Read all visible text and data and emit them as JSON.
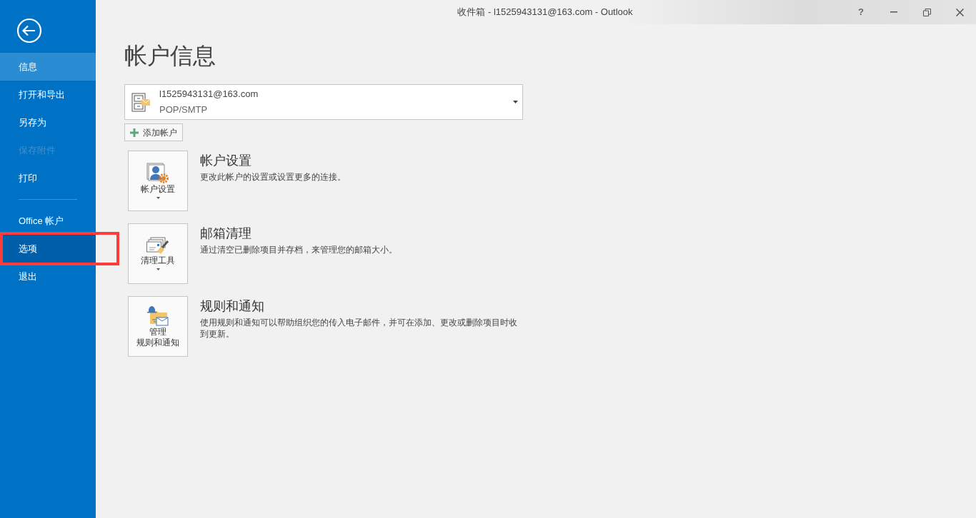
{
  "window": {
    "title": "收件箱 - l1525943131@163.com - Outlook",
    "help": "?"
  },
  "sidebar": {
    "items": [
      {
        "kind": "item",
        "label": "信息",
        "selected": true,
        "disabled": false,
        "hovered": false,
        "marked": false
      },
      {
        "kind": "item",
        "label": "打开和导出",
        "selected": false,
        "disabled": false,
        "hovered": false,
        "marked": false
      },
      {
        "kind": "item",
        "label": "另存为",
        "selected": false,
        "disabled": false,
        "hovered": false,
        "marked": false
      },
      {
        "kind": "item",
        "label": "保存附件",
        "selected": false,
        "disabled": true,
        "hovered": false,
        "marked": false
      },
      {
        "kind": "item",
        "label": "打印",
        "selected": false,
        "disabled": false,
        "hovered": false,
        "marked": false
      },
      {
        "kind": "separator"
      },
      {
        "kind": "item",
        "label": "Office 帐户",
        "selected": false,
        "disabled": false,
        "hovered": false,
        "marked": false
      },
      {
        "kind": "item",
        "label": "选项",
        "selected": false,
        "disabled": false,
        "hovered": true,
        "marked": true
      },
      {
        "kind": "item",
        "label": "退出",
        "selected": false,
        "disabled": false,
        "hovered": false,
        "marked": false
      }
    ]
  },
  "page": {
    "title": "帐户信息",
    "account": {
      "email": "l1525943131@163.com",
      "type": "POP/SMTP"
    },
    "add_account": "添加帐户",
    "sections": [
      {
        "kind": "settings",
        "button": [
          "帐户设置"
        ],
        "dropdown": true,
        "title": "帐户设置",
        "description": "更改此帐户的设置或设置更多的连接。"
      },
      {
        "kind": "cleanup",
        "button": [
          "清理工具"
        ],
        "dropdown": true,
        "title": "邮箱清理",
        "description": "通过清空已删除项目并存档，来管理您的邮箱大小。"
      },
      {
        "kind": "rules",
        "button": [
          "管理",
          "规则和通知"
        ],
        "dropdown": false,
        "title": "规则和通知",
        "description": "使用规则和通知可以帮助组织您的传入电子邮件，并可在添加、更改或删除项目时收到更新。"
      }
    ]
  }
}
